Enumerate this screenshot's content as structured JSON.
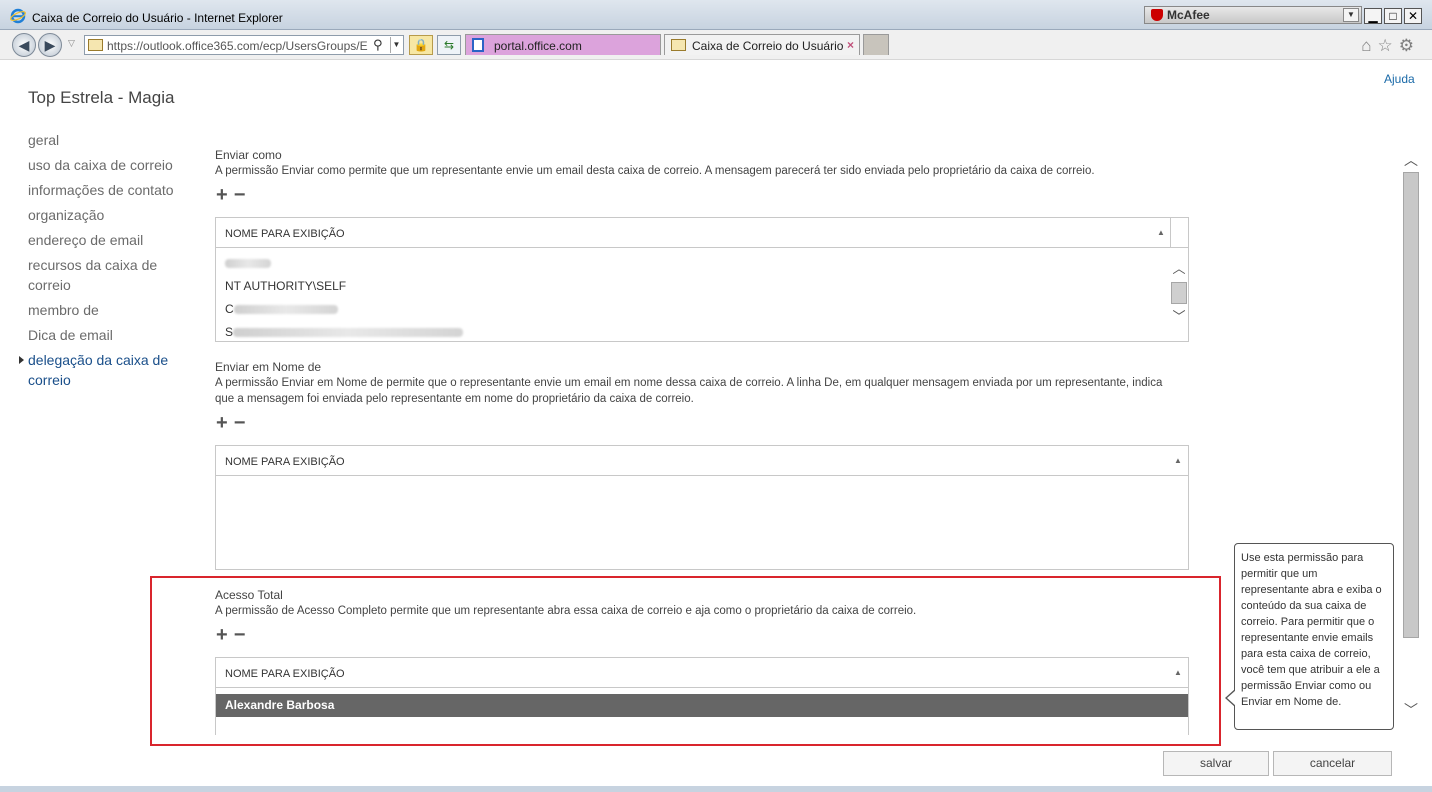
{
  "window": {
    "title": "Caixa de Correio do Usuário - Internet Explorer",
    "mcafee_label": "McAfee",
    "minimize_glyph": "▁",
    "maximize_glyph": "□",
    "close_glyph": "✕"
  },
  "browser": {
    "back_glyph": "◀",
    "forward_glyph": "▶",
    "history_glyph": "▽",
    "address_url": "https://outlook.office365.com/ecp/UsersGroups/E",
    "search_glyph": "⚲",
    "tabs": [
      {
        "label": "portal.office.com",
        "icon": "office-icon"
      },
      {
        "label": "Caixa de Correio do Usuário",
        "icon": "mail-icon",
        "close": "×"
      }
    ],
    "tool_icons": [
      "home-icon",
      "favorites-star-icon",
      "settings-gear-icon"
    ],
    "tool_glyphs": "⌂☆⚙",
    "lock_glyph": "🔒",
    "refresh_glyph": "⇆"
  },
  "header": {
    "help_link": "Ajuda",
    "page_title": "Top Estrela - Magia"
  },
  "sidebar": {
    "items": [
      {
        "label": "geral",
        "active": false
      },
      {
        "label": "uso da caixa de correio",
        "active": false
      },
      {
        "label": "informações de contato",
        "active": false
      },
      {
        "label": "organização",
        "active": false
      },
      {
        "label": "endereço de email",
        "active": false
      },
      {
        "label": "recursos da caixa de correio",
        "active": false
      },
      {
        "label": "membro de",
        "active": false
      },
      {
        "label": "Dica de email",
        "active": false
      },
      {
        "label": "delegação da caixa de correio",
        "active": true
      }
    ]
  },
  "sections": {
    "send_as": {
      "title": "Enviar como",
      "description": "A permissão Enviar como permite que um representante envie um email desta caixa de correio. A mensagem parecerá ter sido enviada pelo proprietário da caixa de correio.",
      "add_glyph": "+",
      "remove_glyph": "−",
      "column_header": "NOME PARA EXIBIÇÃO",
      "sort_glyph": "▲",
      "rows": [
        "",
        "NT AUTHORITY\\SELF",
        "C",
        "S"
      ]
    },
    "send_on_behalf": {
      "title": "Enviar em Nome de",
      "description": "A permissão Enviar em Nome de permite que o representante envie um email em nome dessa caixa de correio. A linha De, em qualquer mensagem enviada por um representante, indica que a mensagem foi enviada pelo representante em nome do proprietário da caixa de correio.",
      "add_glyph": "+",
      "remove_glyph": "−",
      "column_header": "NOME PARA EXIBIÇÃO",
      "sort_glyph": "▲",
      "rows": []
    },
    "full_access": {
      "title": "Acesso Total",
      "description": "A permissão de Acesso Completo permite que um representante abra essa caixa de correio e aja como o proprietário da caixa de correio.",
      "add_glyph": "+",
      "remove_glyph": "−",
      "column_header": "NOME PARA EXIBIÇÃO",
      "sort_glyph": "▲",
      "rows": [
        "Alexandre Barbosa"
      ]
    }
  },
  "tooltip": {
    "text": "Use esta permissão para permitir que um representante abra e exiba o conteúdo da sua caixa de correio. Para permitir que o representante envie emails para esta caixa de correio, você tem que atribuir a ele a permissão Enviar como ou Enviar em Nome de."
  },
  "scroll_glyphs": {
    "up": "︿",
    "down": "﹀"
  },
  "footer": {
    "save_label": "salvar",
    "cancel_label": "cancelar"
  },
  "colors": {
    "highlight_border": "#d9252d",
    "active_nav": "#1a4f8a",
    "selected_row": "#666666",
    "link": "#1a6aa8"
  }
}
